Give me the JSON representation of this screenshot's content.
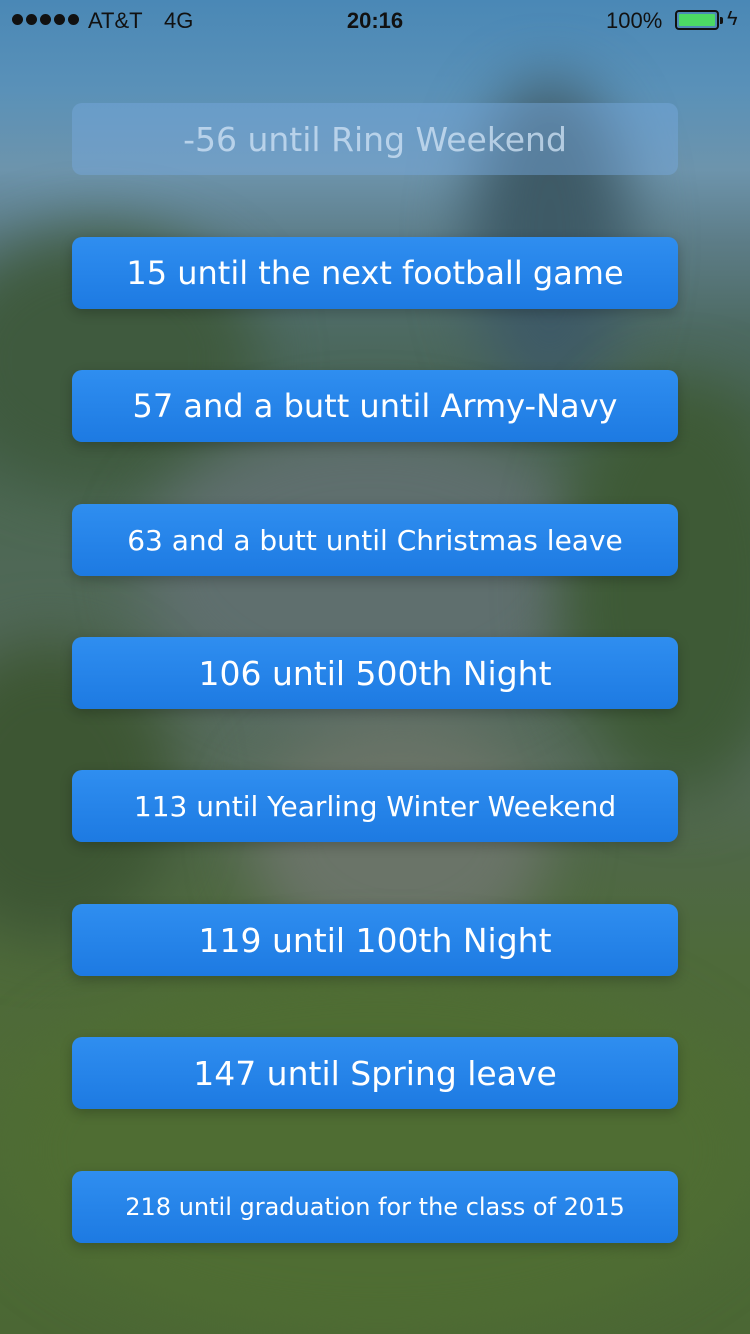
{
  "status_bar": {
    "carrier": "AT&T",
    "network": "4G",
    "time": "20:16",
    "battery_percent": "100%",
    "signal_bars": 5,
    "battery_level": 1.0
  },
  "countdowns": [
    {
      "label": "-56 until Ring Weekend",
      "state": "past"
    },
    {
      "label": "15 until the next football game",
      "state": "upcoming"
    },
    {
      "label": "57 and a butt until Army-Navy",
      "state": "upcoming"
    },
    {
      "label": "63 and a butt until Christmas leave",
      "state": "upcoming"
    },
    {
      "label": "106 until 500th Night",
      "state": "upcoming"
    },
    {
      "label": "113 until Yearling Winter Weekend",
      "state": "upcoming"
    },
    {
      "label": "119 until 100th Night",
      "state": "upcoming"
    },
    {
      "label": "147 until Spring leave",
      "state": "upcoming"
    },
    {
      "label": "218 until graduation for the class of 2015",
      "state": "upcoming"
    }
  ],
  "colors": {
    "button": "#2283e8",
    "button_past": "#7aaade",
    "text": "#ffffff",
    "battery": "#4cd964"
  }
}
